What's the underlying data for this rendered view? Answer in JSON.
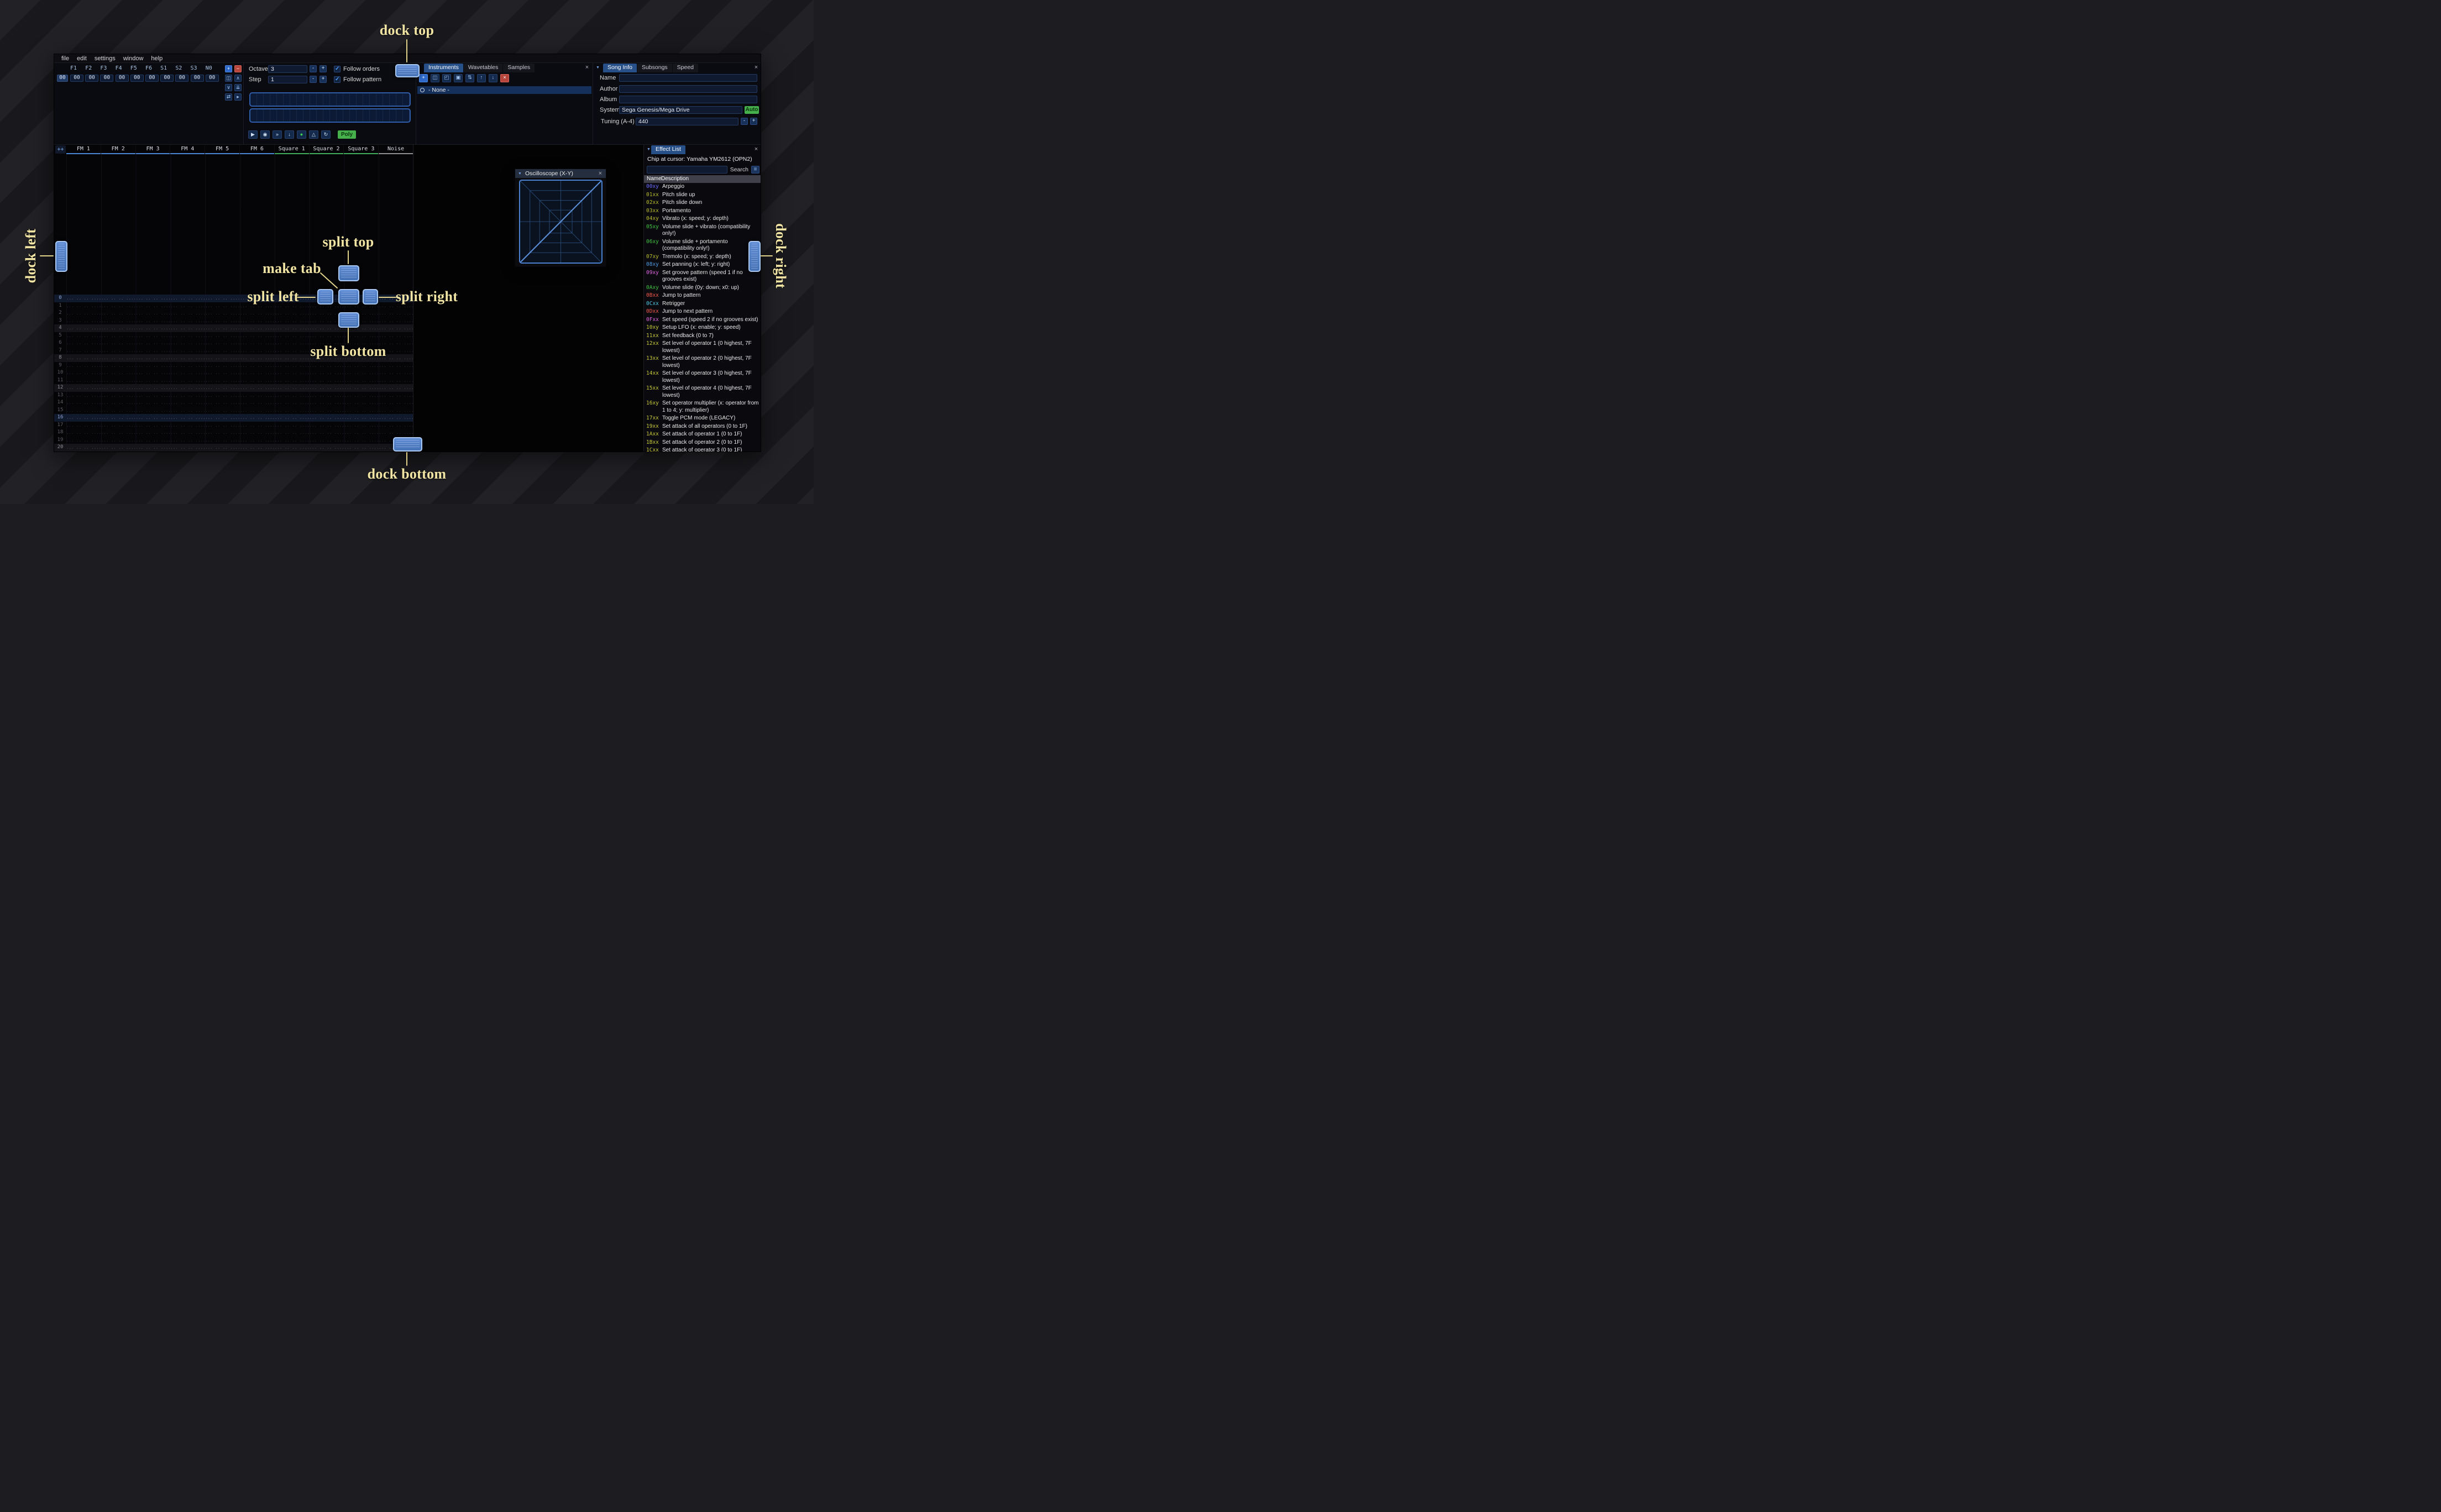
{
  "theme": {
    "accent": "#4e9af5",
    "dock_button_fill": "#4f7fc4",
    "dock_button_border": "#a9c9f2",
    "annotation_color": "#f2e5a4",
    "annotation_line": "#e3d48c",
    "green_button": "#46b14c",
    "channel_colors": {
      "fm": "#4a86d2",
      "square": "#3fae5c",
      "noise": "#8f8f8f"
    }
  },
  "icons": {
    "collapse_glyph": "▼",
    "close_glyph": "×",
    "menu_glyph": "≡"
  },
  "annotations": {
    "dock_top": "dock top",
    "dock_bottom": "dock bottom",
    "dock_left": "dock left",
    "dock_right": "dock right",
    "split_top": "split top",
    "split_bottom": "split bottom",
    "split_left": "split left",
    "split_right": "split right",
    "make_tab": "make tab"
  },
  "menu": {
    "items": [
      "file",
      "edit",
      "settings",
      "window",
      "help"
    ]
  },
  "orders": {
    "header": [
      "F1",
      "F2",
      "F3",
      "F4",
      "F5",
      "F6",
      "S1",
      "S2",
      "S3",
      "N0"
    ],
    "row_index": "00",
    "row_values": [
      "00",
      "00",
      "00",
      "00",
      "00",
      "00",
      "00",
      "00",
      "00",
      "00"
    ],
    "buttons": [
      {
        "name": "add-order",
        "glyph": "+",
        "style": "blue"
      },
      {
        "name": "remove-order",
        "glyph": "−",
        "style": "red"
      },
      {
        "name": "duplicate-order",
        "glyph": "◫",
        "style": ""
      },
      {
        "name": "move-order-up",
        "glyph": "∧",
        "style": ""
      },
      {
        "name": "move-order-down",
        "glyph": "∨",
        "style": ""
      },
      {
        "name": "clone-order-to-end",
        "glyph": "⇊",
        "style": ""
      },
      {
        "name": "change-all-orders",
        "glyph": "⇄",
        "style": ""
      },
      {
        "name": "order-edit-mode",
        "glyph": "▸",
        "style": ""
      }
    ]
  },
  "play_controls": {
    "octave_label": "Octave",
    "octave_value": "3",
    "step_label": "Step",
    "step_value": "1",
    "minus_label": "-",
    "plus_label": "+",
    "follow_orders_label": "Follow orders",
    "follow_pattern_label": "Follow pattern",
    "buttons": [
      {
        "name": "play",
        "glyph": "▶",
        "style": ""
      },
      {
        "name": "play-from-beginning",
        "glyph": "◉",
        "style": ""
      },
      {
        "name": "play-one-row",
        "glyph": "»",
        "style": ""
      },
      {
        "name": "step-one-row",
        "glyph": "↓",
        "style": ""
      },
      {
        "name": "edit-toggle",
        "glyph": "●",
        "style": "green-glyph"
      },
      {
        "name": "metronome",
        "glyph": "△",
        "style": ""
      },
      {
        "name": "repeat-pattern",
        "glyph": "↻",
        "style": ""
      }
    ],
    "poly_label": "Poly"
  },
  "instruments_panel": {
    "tabs": [
      {
        "label": "Instruments",
        "active": true
      },
      {
        "label": "Wavetables",
        "active": false
      },
      {
        "label": "Samples",
        "active": false
      }
    ],
    "toolbar": [
      {
        "name": "add-instrument",
        "glyph": "+",
        "style": "blue"
      },
      {
        "name": "duplicate-instrument",
        "glyph": "◫",
        "style": ""
      },
      {
        "name": "open-instrument",
        "glyph": "◰",
        "style": ""
      },
      {
        "name": "save-instrument",
        "glyph": "▣",
        "style": ""
      },
      {
        "name": "instrument-folders",
        "glyph": "⇅",
        "style": ""
      },
      {
        "name": "move-instrument-up",
        "glyph": "↑",
        "style": ""
      },
      {
        "name": "move-instrument-down",
        "glyph": "↓",
        "style": ""
      },
      {
        "name": "delete-instrument",
        "glyph": "×",
        "style": "red"
      }
    ],
    "list": [
      {
        "label": "- None -",
        "selected": true
      }
    ]
  },
  "song_info": {
    "tabs": [
      {
        "label": "Song Info",
        "active": true
      },
      {
        "label": "Subsongs",
        "active": false
      },
      {
        "label": "Speed",
        "active": false
      }
    ],
    "fields": [
      {
        "label": "Name",
        "value": ""
      },
      {
        "label": "Author",
        "value": ""
      },
      {
        "label": "Album",
        "value": ""
      }
    ],
    "system_label": "System",
    "system_value": "Sega Genesis/Mega Drive",
    "auto_label": "Auto",
    "tuning_label": "Tuning (A-4)",
    "tuning_value": "440"
  },
  "pattern": {
    "expand_label": "++",
    "channels": [
      {
        "name": "FM 1",
        "type": "fm"
      },
      {
        "name": "FM 2",
        "type": "fm"
      },
      {
        "name": "FM 3",
        "type": "fm"
      },
      {
        "name": "FM 4",
        "type": "fm"
      },
      {
        "name": "FM 5",
        "type": "fm"
      },
      {
        "name": "FM 6",
        "type": "fm"
      },
      {
        "name": "Square 1",
        "type": "square"
      },
      {
        "name": "Square 2",
        "type": "square"
      },
      {
        "name": "Square 3",
        "type": "square"
      },
      {
        "name": "Noise",
        "type": "noise"
      }
    ],
    "row_count": 22,
    "empty_cell": "... .. .. ....",
    "highlight_every": 4,
    "strong_highlight_every": 16
  },
  "oscilloscope": {
    "title": "Oscilloscope (X-Y)"
  },
  "effect_list": {
    "tab_label": "Effect List",
    "chip_info": "Chip at cursor: Yamaha YM2612 (OPN2)",
    "search_label": "Search",
    "columns": [
      "Name",
      "Description"
    ],
    "effects": [
      {
        "code": "00xy",
        "color": "#6b6bff",
        "desc": "Arpeggio"
      },
      {
        "code": "01xx",
        "color": "#b9bb2d",
        "desc": "Pitch slide up"
      },
      {
        "code": "02xx",
        "color": "#b9bb2d",
        "desc": "Pitch slide down"
      },
      {
        "code": "03xx",
        "color": "#b9bb2d",
        "desc": "Portamento"
      },
      {
        "code": "04xy",
        "color": "#b9bb2d",
        "desc": "Vibrato (x: speed; y: depth)"
      },
      {
        "code": "05xy",
        "color": "#41c341",
        "desc": "Volume slide + vibrato (compatibility only!)"
      },
      {
        "code": "06xy",
        "color": "#41c341",
        "desc": "Volume slide + portamento (compatibility only!)"
      },
      {
        "code": "07xy",
        "color": "#b9bb2d",
        "desc": "Tremolo (x: speed; y: depth)"
      },
      {
        "code": "08xy",
        "color": "#4f9be0",
        "desc": "Set panning (x: left; y: right)"
      },
      {
        "code": "09xy",
        "color": "#de64de",
        "desc": "Set groove pattern (speed 1 if no grooves exist)"
      },
      {
        "code": "0Axy",
        "color": "#41c341",
        "desc": "Volume slide (0y: down; x0: up)"
      },
      {
        "code": "0Bxx",
        "color": "#f2594a",
        "desc": "Jump to pattern"
      },
      {
        "code": "0Cxx",
        "color": "#52c5e0",
        "desc": "Retrigger"
      },
      {
        "code": "0Dxx",
        "color": "#f2594a",
        "desc": "Jump to next pattern"
      },
      {
        "code": "0Fxx",
        "color": "#de64de",
        "desc": "Set speed (speed 2 if no grooves exist)"
      },
      {
        "code": "10xy",
        "color": "#c9c93a",
        "desc": "Setup LFO (x: enable; y: speed)"
      },
      {
        "code": "11xx",
        "color": "#c9c93a",
        "desc": "Set feedback (0 to 7)"
      },
      {
        "code": "12xx",
        "color": "#c9c93a",
        "desc": "Set level of operator 1 (0 highest, 7F lowest)"
      },
      {
        "code": "13xx",
        "color": "#c9c93a",
        "desc": "Set level of operator 2 (0 highest, 7F lowest)"
      },
      {
        "code": "14xx",
        "color": "#c9c93a",
        "desc": "Set level of operator 3 (0 highest, 7F lowest)"
      },
      {
        "code": "15xx",
        "color": "#c9c93a",
        "desc": "Set level of operator 4 (0 highest, 7F lowest)"
      },
      {
        "code": "16xy",
        "color": "#c9c93a",
        "desc": "Set operator multiplier (x: operator from 1 to 4; y: multiplier)"
      },
      {
        "code": "17xx",
        "color": "#c9c93a",
        "desc": "Toggle PCM mode (LEGACY)"
      },
      {
        "code": "19xx",
        "color": "#c9c93a",
        "desc": "Set attack of all operators (0 to 1F)"
      },
      {
        "code": "1Axx",
        "color": "#c9c93a",
        "desc": "Set attack of operator 1 (0 to 1F)"
      },
      {
        "code": "1Bxx",
        "color": "#c9c93a",
        "desc": "Set attack of operator 2 (0 to 1F)"
      },
      {
        "code": "1Cxx",
        "color": "#c9c93a",
        "desc": "Set attack of operator 3 (0 to 1F)"
      }
    ]
  }
}
